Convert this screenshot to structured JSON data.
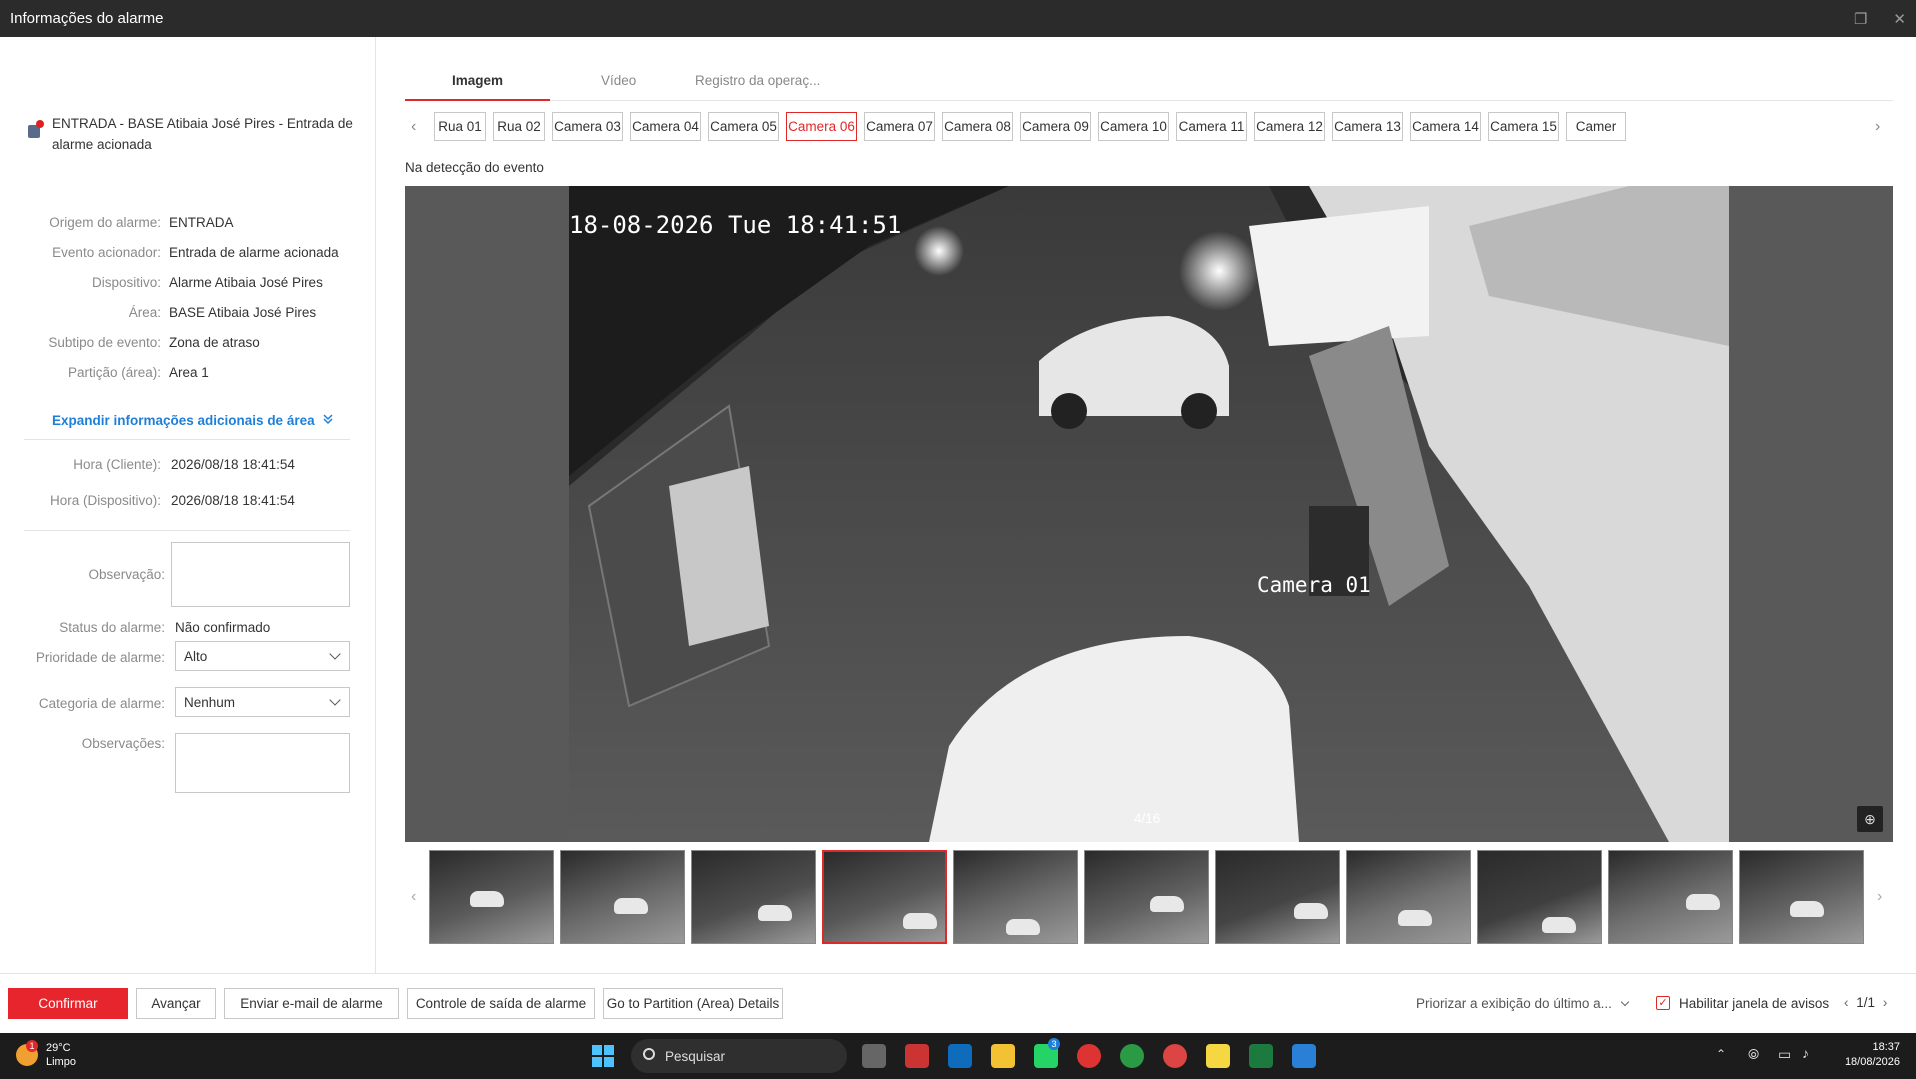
{
  "window": {
    "title": "Informações do alarme"
  },
  "alarm": {
    "headline": "ENTRADA - BASE Atibaia José Pires - Entrada de alarme acionada",
    "details": [
      {
        "label": "Origem do alarme:",
        "value": "ENTRADA"
      },
      {
        "label": "Evento acionador:",
        "value": "Entrada de alarme acionada"
      },
      {
        "label": "Dispositivo:",
        "value": "Alarme Atibaia José Pires"
      },
      {
        "label": "Área:",
        "value": "BASE Atibaia José Pires"
      },
      {
        "label": "Subtipo de evento:",
        "value": "Zona de atraso"
      },
      {
        "label": "Partição (área):",
        "value": "Area 1"
      }
    ],
    "expand_label": "Expandir informações adicionais de área",
    "times": [
      {
        "label": "Hora (Cliente):",
        "value": "2026/08/18 18:41:54"
      },
      {
        "label": "Hora (Dispositivo):",
        "value": "2026/08/18 18:41:54"
      }
    ],
    "form": {
      "observation_label": "Observação:",
      "status_label": "Status do alarme:",
      "status_value": "Não confirmado",
      "priority_label": "Prioridade de alarme:",
      "priority_value": "Alto",
      "category_label": "Categoria de alarme:",
      "category_value": "Nenhum",
      "notes_label": "Observações:"
    }
  },
  "tabs": [
    "Imagem",
    "Vídeo",
    "Registro da operaç..."
  ],
  "cameras": {
    "items": [
      "Rua 01",
      "Rua 02",
      "Camera 03",
      "Camera 04",
      "Camera 05",
      "Camera 06",
      "Camera 07",
      "Camera 08",
      "Camera 09",
      "Camera 10",
      "Camera 11",
      "Camera 12",
      "Camera 13",
      "Camera 14",
      "Camera 15",
      "Camer"
    ],
    "selected_index": 5
  },
  "viewer": {
    "caption": "Na detecção do evento",
    "osd_timestamp": "18-08-2026 Tue 18:41:51",
    "osd_camera": "Camera 01",
    "counter": "4/16"
  },
  "thumbnails": {
    "count": 11,
    "selected_index": 3
  },
  "bottom": {
    "confirm": "Confirmar",
    "next": "Avançar",
    "email": "Enviar e-mail de alarme",
    "output": "Controle de saída de alarme",
    "partition": "Go to Partition (Area) Details",
    "prioritize": "Priorizar a exibição do último a...",
    "enable_popup": "Habilitar janela de avisos",
    "pager": "1/1"
  },
  "taskbar": {
    "temperature": "29°C",
    "weather": "Limpo",
    "search_placeholder": "Pesquisar",
    "time": "18:37",
    "date": "18/08/2026",
    "whatsapp_badge": "3",
    "weather_badge": "1"
  },
  "colors": {
    "accent": "#e02828",
    "link": "#1e7fd8",
    "titlebar": "#2b2b2b",
    "taskbar": "#1c1c1c"
  }
}
